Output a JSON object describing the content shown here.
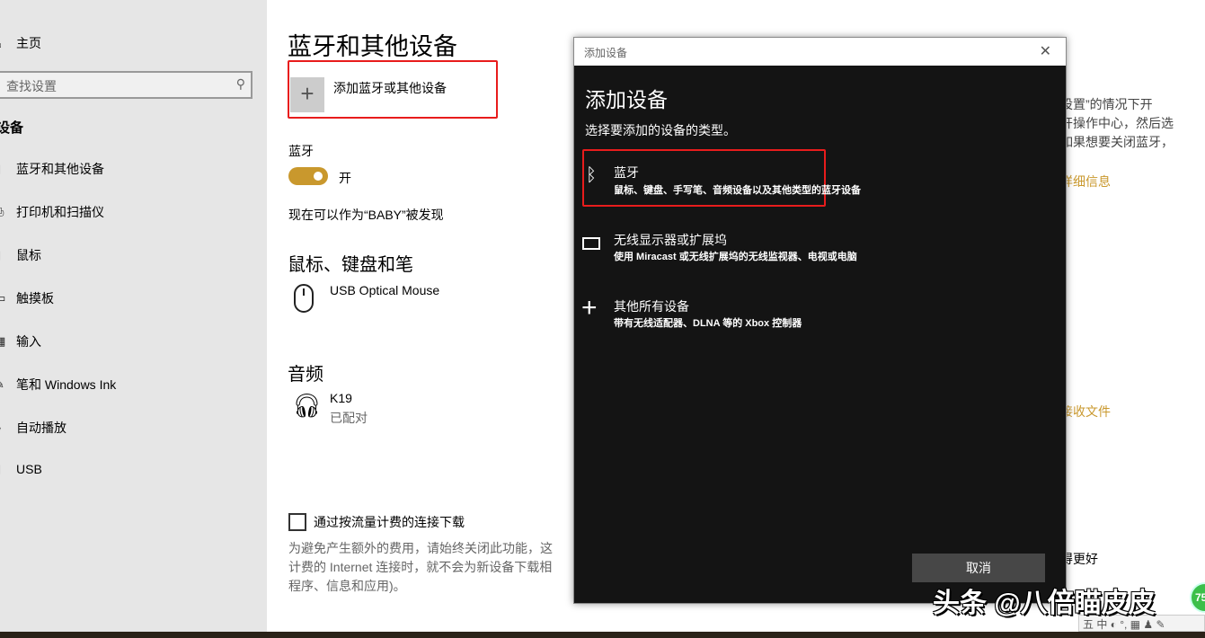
{
  "sidebar": {
    "home": "主页",
    "search_placeholder": "查找设置",
    "section": "设备",
    "items": [
      {
        "label": "蓝牙和其他设备",
        "icon": "bluetooth-devices-icon"
      },
      {
        "label": "打印机和扫描仪",
        "icon": "printer-icon"
      },
      {
        "label": "鼠标",
        "icon": "mouse-icon"
      },
      {
        "label": "触摸板",
        "icon": "touchpad-icon"
      },
      {
        "label": "输入",
        "icon": "keyboard-icon"
      },
      {
        "label": "笔和 Windows Ink",
        "icon": "pen-icon"
      },
      {
        "label": "自动播放",
        "icon": "autoplay-icon"
      },
      {
        "label": "USB",
        "icon": "usb-icon"
      }
    ]
  },
  "main": {
    "title": "蓝牙和其他设备",
    "add_device": "添加蓝牙或其他设备",
    "bluetooth_label": "蓝牙",
    "bluetooth_state": "开",
    "bluetooth_on": true,
    "discoverable": "现在可以作为“BABY”被发现",
    "mouse_section": "鼠标、键盘和笔",
    "mouse_device": "USB Optical Mouse",
    "audio_section": "音频",
    "audio_device": "K19",
    "audio_status": "已配对",
    "metered_label": "通过按流量计费的连接下载",
    "metered_checked": false,
    "metered_desc": [
      "为避免产生额外的费用，请始终关闭此功能，这",
      "计费的 Internet 连接时，就不会为新设备下载相",
      "程序、信息和应用)。"
    ],
    "right_text": [
      "设置”的情况下开",
      "开操作中心，然后选",
      "如果想要关闭蓝牙，",
      "。"
    ],
    "link_details": "详细信息",
    "link_receive": "接收文件",
    "right_bottom": "得更好"
  },
  "dialog": {
    "window_title": "添加设备",
    "heading": "添加设备",
    "subtitle": "选择要添加的设备的类型。",
    "options": [
      {
        "title": "蓝牙",
        "desc": "鼠标、键盘、手写笔、音频设备以及其他类型的蓝牙设备",
        "icon": "bluetooth-icon"
      },
      {
        "title": "无线显示器或扩展坞",
        "desc": "使用 Miracast 或无线扩展坞的无线监视器、电视或电脑",
        "icon": "monitor-icon"
      },
      {
        "title": "其他所有设备",
        "desc": "带有无线适配器、DLNA 等的 Xbox 控制器",
        "icon": "plus-icon"
      }
    ],
    "cancel": "取消"
  },
  "overlay": {
    "watermark": "头条 @八倍瞄皮皮",
    "badge": "75",
    "ime": "五 中 ◐ °, ▦ ♟ ✎"
  },
  "colors": {
    "accent": "#c9982d",
    "highlight": "#e81c1c",
    "dialog_bg": "#141414"
  }
}
